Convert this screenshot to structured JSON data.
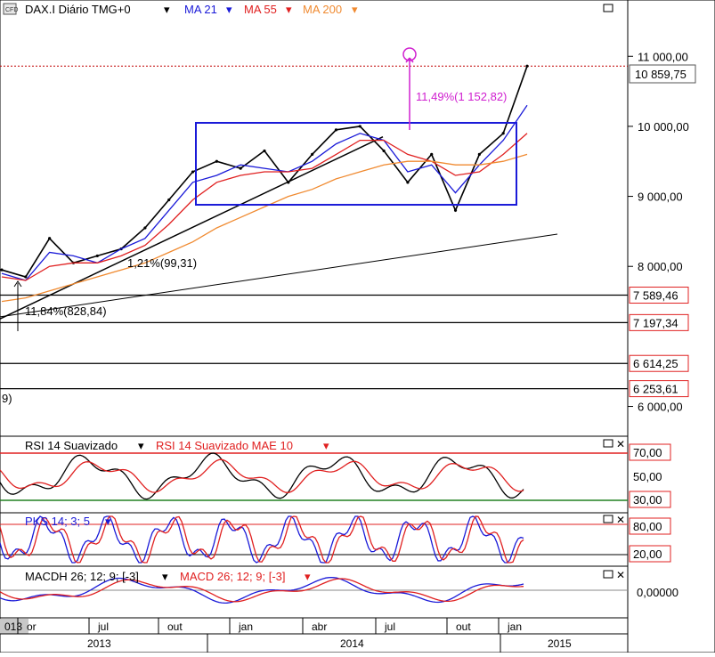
{
  "main_panel": {
    "instrument": "DAX.I Diário TMG+0",
    "ma_labels": [
      {
        "text": "MA 21",
        "color": "#1a1ad8"
      },
      {
        "text": "MA 55",
        "color": "#e02020"
      },
      {
        "text": "MA 200",
        "color": "#f08a30"
      }
    ],
    "price_axis_ticks": [
      "11 000,00",
      "10 000,00",
      "9 000,00",
      "8 000,00",
      "6 000,00"
    ],
    "price_axis_values": [
      11000,
      10000,
      9000,
      8000,
      6000
    ],
    "current_price_label": "10 859,75",
    "horizontal_level_labels": [
      "7 589,46",
      "7 197,34",
      "6 614,25",
      "6 253,61"
    ],
    "horizontal_level_values": [
      7589.46,
      7197.34,
      6614.25,
      6253.61
    ],
    "partial_level_labels": [
      "",
      "6 ..."
    ],
    "annotations": [
      {
        "text": "11,49%(1 152,82)",
        "color": "#d020d0"
      },
      {
        "text": "1,21%(99,31)",
        "color": "#000000"
      },
      {
        "text": "11,84%(828,84)",
        "color": "#000000"
      },
      {
        "text": "9)",
        "color": "#000000"
      }
    ],
    "y_range": [
      5600,
      11550
    ]
  },
  "rsi_panel": {
    "label_1": "RSI 14 Suavizado",
    "label_2": "RSI 14 Suavizado MAE 10",
    "levels": [
      "70,00",
      "50,00",
      "30,00"
    ],
    "level_values": [
      70,
      50,
      30
    ]
  },
  "pks_panel": {
    "label": "PKS 14; 3; 5",
    "levels": [
      "80,00",
      "20,00"
    ],
    "level_values": [
      80,
      20
    ]
  },
  "macd_panel": {
    "label_1": "MACDH 26; 12; 9; [-3]",
    "label_2": "MACD 26; 12; 9; [-3]",
    "levels": [
      "0,00000"
    ]
  },
  "time_axis": {
    "month_ticks": [
      "013",
      "or",
      "jul",
      "out",
      "jan",
      "abr",
      "jul",
      "out",
      "jan"
    ],
    "years": [
      "2013",
      "2014",
      "2015"
    ]
  },
  "colors": {
    "price": "#000000",
    "ma21": "#1a1ad8",
    "ma55": "#e02020",
    "ma200": "#f08a30",
    "rsi": "#000000",
    "rsi_ma": "#e02020",
    "pks_fast": "#1a1ad8",
    "pks_slow": "#e02020",
    "annotation_magenta": "#d020d0"
  },
  "chart_data": {
    "type": "line",
    "title": "DAX.I Diário TMG+0",
    "x": [
      "2013-03",
      "2013-04",
      "2013-05",
      "2013-06",
      "2013-07",
      "2013-08",
      "2013-09",
      "2013-10",
      "2013-11",
      "2013-12",
      "2014-01",
      "2014-02",
      "2014-03",
      "2014-04",
      "2014-05",
      "2014-06",
      "2014-07",
      "2014-08",
      "2014-09",
      "2014-10",
      "2014-11",
      "2014-12",
      "2015-01"
    ],
    "series": [
      {
        "name": "DAX.I",
        "values": [
          7950,
          7850,
          8400,
          8050,
          8150,
          8250,
          8550,
          8950,
          9350,
          9500,
          9400,
          9650,
          9200,
          9600,
          9950,
          10000,
          9650,
          9200,
          9600,
          8800,
          9600,
          9900,
          10860
        ]
      },
      {
        "name": "MA 21",
        "values": [
          7900,
          7800,
          8200,
          8150,
          8050,
          8250,
          8400,
          8800,
          9200,
          9300,
          9450,
          9400,
          9350,
          9500,
          9750,
          9900,
          9800,
          9350,
          9450,
          9050,
          9450,
          9800,
          10300
        ]
      },
      {
        "name": "MA 55",
        "values": [
          7850,
          7800,
          8000,
          8050,
          8050,
          8150,
          8300,
          8600,
          8950,
          9200,
          9300,
          9350,
          9350,
          9400,
          9600,
          9800,
          9800,
          9600,
          9500,
          9300,
          9350,
          9600,
          9900
        ]
      },
      {
        "name": "MA 200",
        "values": [
          7500,
          7550,
          7650,
          7750,
          7850,
          7950,
          8050,
          8200,
          8350,
          8550,
          8700,
          8850,
          9000,
          9100,
          9250,
          9350,
          9450,
          9500,
          9500,
          9450,
          9450,
          9500,
          9600
        ]
      }
    ],
    "ylim": [
      5600,
      11550
    ]
  }
}
